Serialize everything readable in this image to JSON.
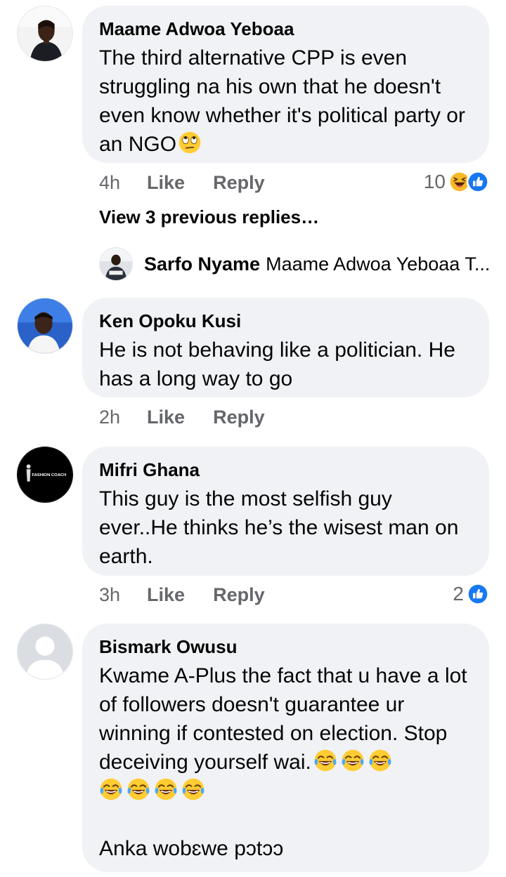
{
  "comments": [
    {
      "author": "Maame Adwoa Yeboaa",
      "text": "The third alternative CPP is even struggling na his own that he doesn't even know whether it's political party or an NGO",
      "time": "4h",
      "like_label": "Like",
      "reply_label": "Reply",
      "reaction_count": "10",
      "reactions": [
        "haha-icon",
        "like-icon"
      ]
    },
    {
      "author": "Ken Opoku Kusi",
      "text": "He is not behaving like a politician. He has a long way to go",
      "time": "2h",
      "like_label": "Like",
      "reply_label": "Reply"
    },
    {
      "author": "Mifri Ghana",
      "text": "This guy is the most selfish guy ever..He thinks he’s the wisest man on earth.",
      "time": "3h",
      "like_label": "Like",
      "reply_label": "Reply",
      "reaction_count": "2",
      "reactions": [
        "like-icon"
      ],
      "avatar_text": "FASHION COACH"
    },
    {
      "author": "Bismark Owusu",
      "text_line1": "Kwame A-Plus the fact that u have a lot of followers doesn't guarantee ur winning if contested on election. Stop deceiving yourself wai.",
      "text_line2": "Anka wobɛwe pɔtɔɔ",
      "emoji": "tears-of-joy-icon"
    }
  ],
  "view_previous": "View 3 previous replies…",
  "latest_reply": {
    "author": "Sarfo Nyame",
    "snippet": "Maame Adwoa Yeboaa T..."
  },
  "colors": {
    "bubble": "#f0f2f5",
    "meta": "#65676b",
    "like_blue": "#1877f2",
    "haha_yellow": "#f7b928"
  }
}
